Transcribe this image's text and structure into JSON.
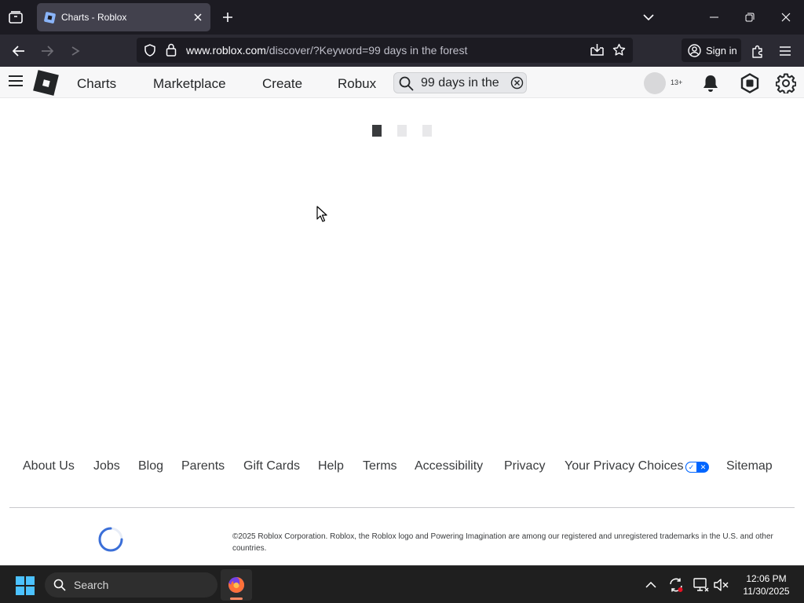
{
  "browser": {
    "tab_title": "Charts - Roblox",
    "url_host": "www.roblox.com",
    "url_path": "/discover/?Keyword=99 days in the forest",
    "sign_in_label": "Sign in"
  },
  "header": {
    "nav": [
      "Charts",
      "Marketplace",
      "Create",
      "Robux"
    ],
    "search_value": "99 days in the",
    "age_badge": "13+"
  },
  "footer": {
    "links": [
      "About Us",
      "Jobs",
      "Blog",
      "Parents",
      "Gift Cards",
      "Help",
      "Terms",
      "Accessibility",
      "Privacy",
      "Your Privacy Choices",
      "Sitemap"
    ],
    "copyright": "©2025 Roblox Corporation. Roblox, the Roblox logo and Powering Imagination are among our registered and unregistered trademarks in the U.S. and other countries."
  },
  "taskbar": {
    "search_label": "Search",
    "time": "12:06 PM",
    "date": "11/30/2025"
  },
  "colors": {
    "accent": "#0066ff",
    "browser_dark": "#1c1b22",
    "roblox_header": "#f7f7f8"
  }
}
